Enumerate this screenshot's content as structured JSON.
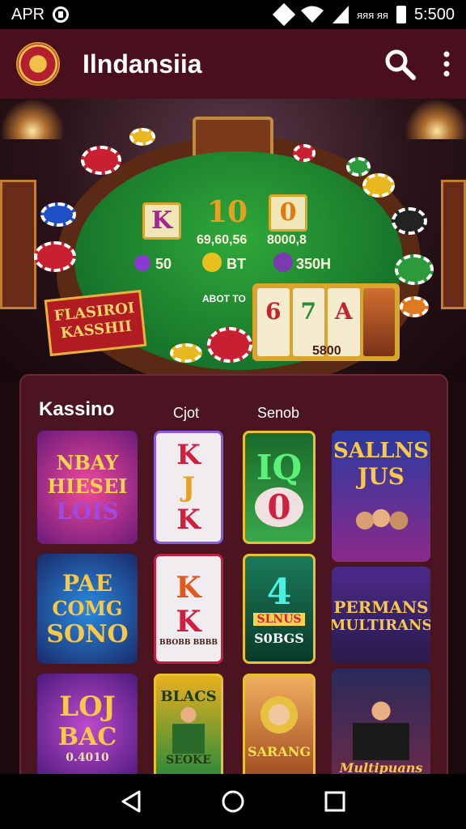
{
  "status_bar": {
    "carrier": "APR",
    "network_label": "ᴙᴙᴙ ᴙᴙ",
    "time": "5:500"
  },
  "app_bar": {
    "title": "Ilndansiia"
  },
  "hero": {
    "felt_cards": [
      "K",
      "10",
      "0"
    ],
    "felt_numbers": [
      "69,60,56",
      "8000,8"
    ],
    "bet_labels": [
      "50",
      "BT",
      "350H"
    ],
    "table_sign": "ABOT TO",
    "banner_text": "FLASIROI KASSHII",
    "slot_reels": [
      "6",
      "7",
      "A"
    ],
    "slot_footer": "5800"
  },
  "casino_panel": {
    "title": "Kassino",
    "tabs": [
      "Cjot",
      "Senob"
    ],
    "tiles": [
      {
        "line1": "NBAY",
        "line2": "HIESEI",
        "line3": "LOIS"
      },
      {
        "line1": "K",
        "line2": "J",
        "line3": "K"
      },
      {
        "line1": "IQ",
        "line2": "0"
      },
      {
        "line1": "SALLNS",
        "line2": "JUS"
      },
      {
        "line1": "PAE",
        "line2": "COMG",
        "line3": "SONO"
      },
      {
        "line1": "K",
        "line2": "K",
        "line3": "BBOBB BBBB"
      },
      {
        "line1": "4",
        "line2": "SLNUS",
        "line3": "S0BGS"
      },
      {
        "line1": "PERMANS",
        "line2": "MULTIRANS"
      },
      {
        "line1": "LOJ",
        "line2": "BAC",
        "line3": "0.4010"
      },
      {
        "line1": "BLACS",
        "line2": "SEOKE"
      },
      {
        "line1": "SARANG",
        "line2": ""
      },
      {
        "line1": "Multipuans"
      }
    ]
  },
  "colors": {
    "app_bar": "#4a0f1c",
    "panel": "#4a1420",
    "felt": "#17752a",
    "gold": "#d9a52a"
  }
}
